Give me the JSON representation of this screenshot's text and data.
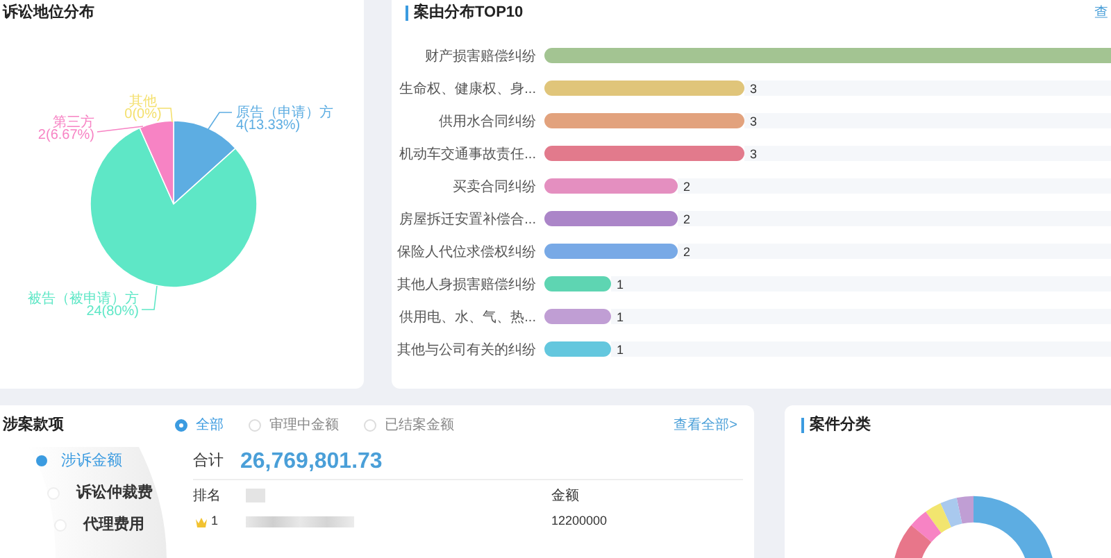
{
  "litigation_position": {
    "title": "诉讼地位分布",
    "chart_data": {
      "type": "pie",
      "categories": [
        "原告（申请）方",
        "被告（被申请）方",
        "第三方",
        "其他"
      ],
      "values": [
        4,
        24,
        2,
        0
      ],
      "value_labels": [
        "4(13.33%)",
        "24(80%)",
        "2(6.67%)",
        "0(0%)"
      ],
      "colors": [
        "#5dade2",
        "#5ee7c6",
        "#f783c4",
        "#f4e06d"
      ]
    }
  },
  "cause_top10": {
    "title": "案由分布TOP10",
    "link": "查",
    "chart_data": {
      "type": "bar",
      "orientation": "horizontal",
      "categories": [
        "财产损害赔偿纠纷",
        "生命权、健康权、身...",
        "供用水合同纠纷",
        "机动车交通事故责任...",
        "买卖合同纠纷",
        "房屋拆迁安置补偿合...",
        "保险人代位求偿权纠纷",
        "其他人身损害赔偿纠纷",
        "供用电、水、气、热...",
        "其他与公司有关的纠纷"
      ],
      "values": [
        null,
        3,
        3,
        3,
        2,
        2,
        2,
        1,
        1,
        1
      ],
      "data_labels": true,
      "colors": [
        "#a3c492",
        "#e0c57a",
        "#e2a27d",
        "#e27a8c",
        "#e48fc0",
        "#ab85c8",
        "#78a9e6",
        "#5ed5b2",
        "#c09ed4",
        "#63c7de"
      ]
    }
  },
  "case_amounts": {
    "title": "涉案款项",
    "filters": [
      {
        "label": "全部",
        "selected": true
      },
      {
        "label": "审理中金额",
        "selected": false
      },
      {
        "label": "已结案金额",
        "selected": false
      }
    ],
    "link": "查看全部>",
    "menu": [
      {
        "label": "涉诉金额",
        "selected": true
      },
      {
        "label": "诉讼仲裁费",
        "selected": false
      },
      {
        "label": "代理费用",
        "selected": false
      }
    ],
    "total_label": "合计",
    "total": "26,769,801.73",
    "table": {
      "columns": [
        "排名",
        "金额"
      ],
      "rows": [
        {
          "rank": "1",
          "amount": "12200000"
        }
      ]
    }
  },
  "case_category": {
    "title": "案件分类"
  }
}
